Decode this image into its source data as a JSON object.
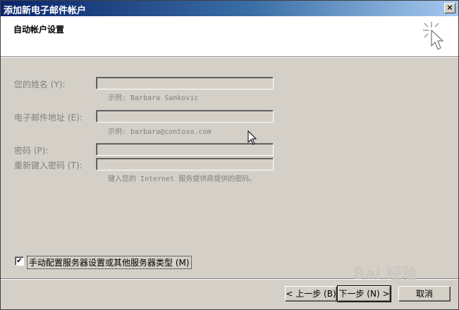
{
  "window": {
    "title": "添加新电子邮件帐户",
    "close_glyph": "×"
  },
  "header": {
    "title": "自动帐户设置",
    "icon": "wizard-sparkle-cursor-icon"
  },
  "form": {
    "name": {
      "label": "您的姓名 (Y):",
      "value": "",
      "hint": "示例: Barbara Sankovic"
    },
    "email": {
      "label": "电子邮件地址 (E):",
      "value": "",
      "hint": "示例: barbara@contoso.com"
    },
    "password": {
      "label": "密码 (P):",
      "value": ""
    },
    "retype_password": {
      "label": "重新键入密码 (T):",
      "value": ""
    },
    "password_hint": "键入您的 Internet 服务提供商提供的密码。"
  },
  "manual_config": {
    "label": "手动配置服务器设置或其他服务器类型 (M)",
    "checked": true,
    "check_glyph": "✔"
  },
  "buttons": {
    "back": "< 上一步 (B)",
    "next": "下一步 (N) >",
    "cancel": "取消"
  },
  "watermark": {
    "text": "Bai 经验",
    "sub": "jingyan.baidu.com"
  }
}
